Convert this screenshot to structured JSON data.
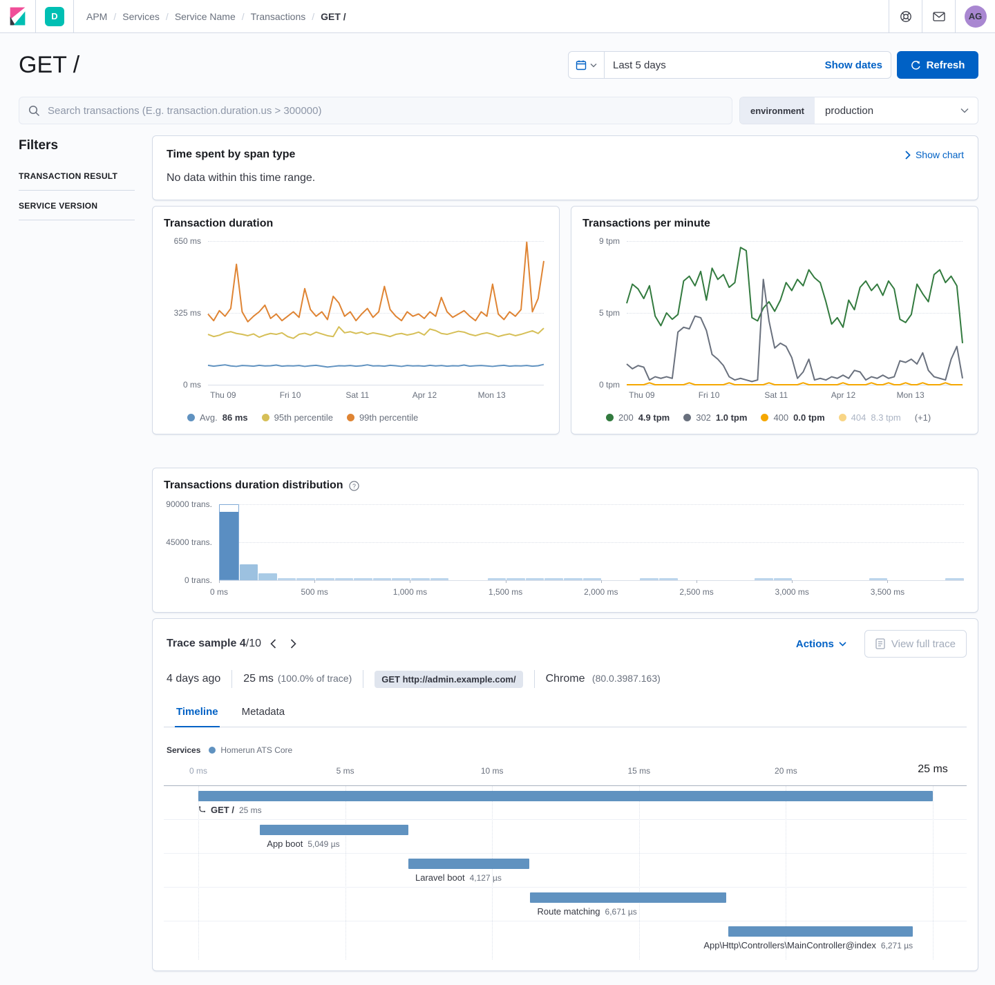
{
  "colors": {
    "accent": "#0061C5",
    "logo_pink": "#F04E98",
    "logo_teal": "#00BFB3",
    "logo_dark": "#343741",
    "space_badge_bg": "#00BFB3",
    "avatar_bg": "#A987D1",
    "waterfall_bar": "#6092C0",
    "histogram_selected": "#5A8EC2"
  },
  "topbar": {
    "space_badge": "D",
    "breadcrumbs": [
      "APM",
      "Services",
      "Service Name",
      "Transactions",
      "GET /"
    ],
    "separator": "/",
    "avatar": "AG"
  },
  "header": {
    "title": "GET /",
    "time_range": "Last 5 days",
    "show_dates": "Show dates",
    "refresh": "Refresh"
  },
  "search": {
    "placeholder": "Search transactions (E.g. transaction.duration.us > 300000)",
    "environment_label": "environment",
    "environment_value": "production"
  },
  "filters": {
    "title": "Filters",
    "sections": [
      "TRANSACTION RESULT",
      "SERVICE VERSION"
    ]
  },
  "span_type": {
    "title": "Time spent by span type",
    "message": "No data within this time range.",
    "show_chart": "Show chart"
  },
  "trace": {
    "title": "Trace sample 4",
    "title_suffix": "/10",
    "actions": "Actions",
    "view_full_trace": "View full trace",
    "age": "4 days ago",
    "duration": "25 ms",
    "duration_pct": "(100.0% of trace)",
    "badge": "GET http://admin.example.com/",
    "browser": "Chrome",
    "browser_version": "(80.0.3987.163)",
    "tabs": [
      "Timeline",
      "Metadata"
    ],
    "active_tab": "Timeline",
    "services_label": "Services",
    "service_name": "Homerun ATS Core",
    "service_color": "#6092C0"
  },
  "chart_data": [
    {
      "id": "transaction_duration",
      "type": "line",
      "title": "Transaction duration",
      "ylim": [
        0,
        650
      ],
      "y_ticks": [
        "650 ms",
        "325 ms",
        "0 ms"
      ],
      "x_ticks": [
        "Thu 09",
        "Fri 10",
        "Sat 11",
        "Apr 12",
        "Mon 13"
      ],
      "legend_position": "bottom",
      "grid": "dotted-horizontal",
      "series": [
        {
          "name": "Avg.",
          "value": "86 ms",
          "color": "#6092C0",
          "values": [
            88,
            84,
            87,
            90,
            85,
            83,
            87,
            86,
            84,
            88,
            85,
            86,
            89,
            84,
            86,
            85,
            87,
            83,
            86,
            88,
            84,
            80,
            83,
            86,
            85,
            87,
            84,
            86,
            90,
            85,
            86,
            84,
            88,
            86,
            83,
            87,
            85,
            86,
            84,
            88,
            85,
            87,
            84,
            86,
            85,
            89,
            84,
            86,
            87,
            85,
            83,
            86,
            88,
            84,
            86,
            85,
            87,
            84,
            86,
            92
          ]
        },
        {
          "name": "95th percentile",
          "value": "",
          "color": "#D6BF57",
          "values": [
            228,
            218,
            224,
            235,
            240,
            232,
            228,
            222,
            230,
            215,
            225,
            232,
            228,
            235,
            218,
            210,
            228,
            233,
            225,
            238,
            230,
            222,
            218,
            262,
            235,
            240,
            232,
            238,
            228,
            235,
            230,
            225,
            218,
            228,
            232,
            225,
            230,
            238,
            225,
            252,
            245,
            232,
            228,
            235,
            242,
            238,
            228,
            222,
            230,
            235,
            228,
            218,
            225,
            230,
            222,
            228,
            236,
            244,
            232,
            256
          ]
        },
        {
          "name": "99th percentile",
          "value": "",
          "color": "#DF8433",
          "values": [
            320,
            290,
            335,
            310,
            345,
            545,
            330,
            285,
            310,
            330,
            360,
            300,
            320,
            290,
            310,
            330,
            305,
            435,
            340,
            310,
            330,
            295,
            400,
            370,
            310,
            330,
            290,
            320,
            345,
            305,
            330,
            445,
            340,
            310,
            290,
            330,
            310,
            320,
            300,
            330,
            310,
            395,
            330,
            305,
            320,
            335,
            310,
            290,
            330,
            310,
            455,
            320,
            295,
            330,
            310,
            340,
            645,
            330,
            390,
            560
          ]
        }
      ]
    },
    {
      "id": "transactions_per_minute",
      "type": "line",
      "title": "Transactions per minute",
      "ylim": [
        0,
        9
      ],
      "y_ticks": [
        "9 tpm",
        "5 tpm",
        "0 tpm"
      ],
      "x_ticks": [
        "Thu 09",
        "Fri 10",
        "Sat 11",
        "Apr 12",
        "Mon 13"
      ],
      "legend_position": "bottom",
      "grid": "dotted-horizontal",
      "legend_extra": "(+1)",
      "series": [
        {
          "name": "200",
          "value": "4.9 tpm",
          "color": "#327A3E",
          "values": [
            5.1,
            6.3,
            6.0,
            5.4,
            6.2,
            4.3,
            3.7,
            4.5,
            4.1,
            4.4,
            6.5,
            6.8,
            6.2,
            7.1,
            5.3,
            7.3,
            6.6,
            6.9,
            6.1,
            6.4,
            8.6,
            8.4,
            4.2,
            4.0,
            4.8,
            5.2,
            4.6,
            5.3,
            6.4,
            5.9,
            6.6,
            6.2,
            7.2,
            6.7,
            6.4,
            5.2,
            3.8,
            4.2,
            3.6,
            5.3,
            4.7,
            6.1,
            6.5,
            5.9,
            6.3,
            5.6,
            6.5,
            6.0,
            4.1,
            3.9,
            4.4,
            6.3,
            5.7,
            5.2,
            6.9,
            7.2,
            6.4,
            6.8,
            6.2,
            2.6
          ]
        },
        {
          "name": "302",
          "value": "1.0 tpm",
          "color": "#69707D",
          "values": [
            1.3,
            1.0,
            1.2,
            1.1,
            0.3,
            0.5,
            0.4,
            0.5,
            0.4,
            3.3,
            3.6,
            3.5,
            4.3,
            4.2,
            3.4,
            1.9,
            1.6,
            1.2,
            0.5,
            0.3,
            0.4,
            0.3,
            0.2,
            0.3,
            6.6,
            4.0,
            2.3,
            2.6,
            2.4,
            1.7,
            0.4,
            0.8,
            1.6,
            0.3,
            0.4,
            0.3,
            0.5,
            0.4,
            0.6,
            0.4,
            0.9,
            0.8,
            0.3,
            0.5,
            0.4,
            0.6,
            0.4,
            0.5,
            1.5,
            1.4,
            1.6,
            1.3,
            2.0,
            0.9,
            0.5,
            0.4,
            0.3,
            1.6,
            2.4,
            0.4
          ]
        },
        {
          "name": "400",
          "value": "0.0 tpm",
          "color": "#F5A700",
          "values": [
            0,
            0,
            0,
            0,
            0.12,
            0,
            0,
            0,
            0,
            0,
            0,
            0.12,
            0,
            0,
            0,
            0,
            0,
            0,
            0.12,
            0,
            0,
            0,
            0,
            0,
            0,
            0.12,
            0,
            0,
            0,
            0,
            0,
            0.12,
            0,
            0,
            0,
            0,
            0,
            0,
            0.12,
            0,
            0,
            0,
            0,
            0.12,
            0,
            0,
            0.12,
            0,
            0,
            0.12,
            0,
            0,
            0.12,
            0,
            0,
            0,
            0.12,
            0,
            0,
            0
          ]
        },
        {
          "name": "404",
          "value": "8.3 tpm",
          "color": "#F8D586",
          "dimmed": true,
          "values": []
        }
      ]
    },
    {
      "id": "duration_distribution",
      "type": "histogram",
      "title": "Transactions duration distribution",
      "ylim": [
        0,
        90000
      ],
      "y_ticks": [
        "90000 trans.",
        "45000 trans.",
        "0 trans."
      ],
      "x_ticks": [
        "0 ms",
        "500 ms",
        "1,000 ms",
        "1,500 ms",
        "2,000 ms",
        "2,500 ms",
        "3,000 ms",
        "3,500 ms"
      ],
      "bucket_ms": 100,
      "selected_bucket": 0,
      "selected_fill": 82000,
      "values": [
        90000,
        19000,
        8500,
        2400,
        2400,
        2400,
        2400,
        2400,
        2400,
        2400,
        2400,
        2500,
        0,
        0,
        2400,
        2400,
        2400,
        2400,
        2400,
        2500,
        0,
        0,
        2400,
        2500,
        0,
        0,
        0,
        0,
        2400,
        2500,
        0,
        0,
        0,
        0,
        2500,
        0,
        0,
        0,
        2400
      ]
    },
    {
      "id": "trace_waterfall",
      "type": "waterfall",
      "total_us": 25000,
      "x_ticks": [
        "0 ms",
        "5 ms",
        "10 ms",
        "15 ms",
        "20 ms",
        "25 ms"
      ],
      "items": [
        {
          "name": "GET /",
          "duration_label": "25 ms",
          "start_us": 0,
          "duration_us": 25000,
          "is_transaction": true
        },
        {
          "name": "App boot",
          "duration_label": "5,049 µs",
          "start_us": 2100,
          "duration_us": 5049
        },
        {
          "name": "Laravel boot",
          "duration_label": "4,127 µs",
          "start_us": 7150,
          "duration_us": 4127
        },
        {
          "name": "Route matching",
          "duration_label": "6,671 µs",
          "start_us": 11300,
          "duration_us": 6671
        },
        {
          "name": "App\\Http\\Controllers\\MainController@index",
          "duration_label": "6,271 µs",
          "start_us": 18050,
          "duration_us": 6271,
          "label_align": "right"
        }
      ]
    }
  ]
}
